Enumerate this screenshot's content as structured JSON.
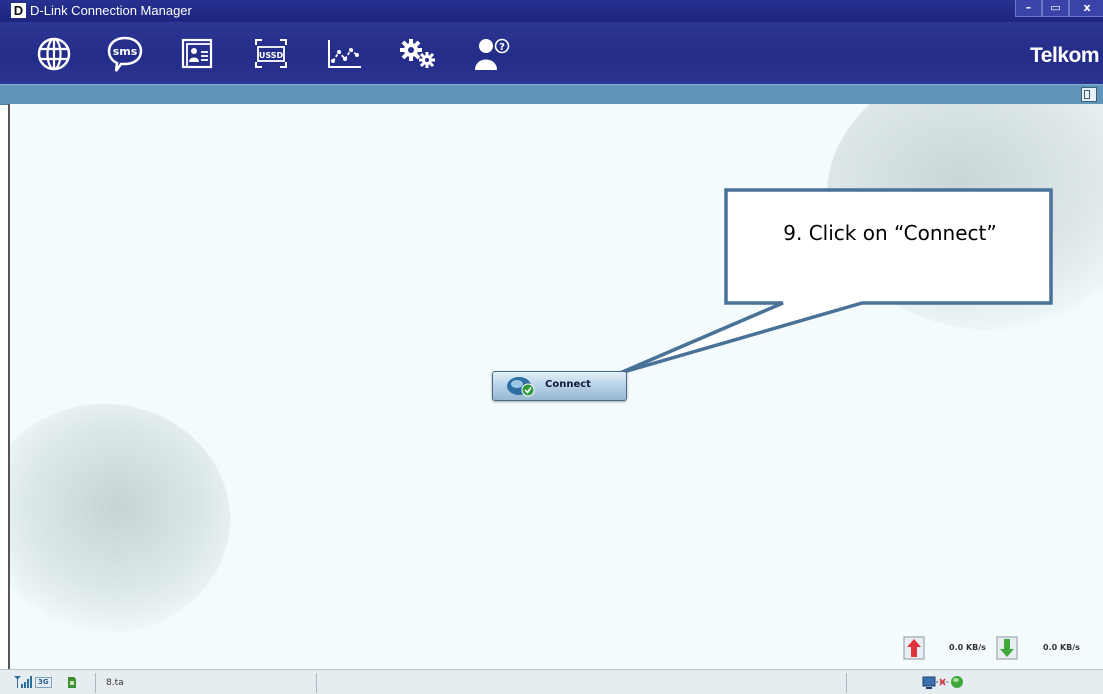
{
  "window": {
    "title": "D-Link Connection Manager",
    "logo_letter": "D",
    "controls": {
      "minimize": "–",
      "maximize": "▭",
      "close": "x"
    }
  },
  "toolbar": {
    "brand": "Telkom",
    "items": [
      {
        "name": "internet",
        "icon": "globe-icon"
      },
      {
        "name": "sms",
        "icon": "sms-bubble-icon",
        "icon_text": "sms"
      },
      {
        "name": "contacts",
        "icon": "contacts-card-icon"
      },
      {
        "name": "ussd",
        "icon": "ussd-icon",
        "icon_text": "USSD"
      },
      {
        "name": "statistics",
        "icon": "line-chart-icon"
      },
      {
        "name": "settings",
        "icon": "gears-icon"
      },
      {
        "name": "help",
        "icon": "help-user-icon"
      }
    ]
  },
  "main": {
    "connect_label": "Connect",
    "callout_text": "9. Click on “Connect”",
    "upload_speed": "0.0 KB/s",
    "download_speed": "0.0 KB/s"
  },
  "statusbar": {
    "network_type": "3G",
    "text": "8.ta"
  },
  "colors": {
    "title_bar": "#1c2580",
    "toolbar": "#232c88",
    "sub_bar": "#5f95b8",
    "main_bg": "#f3fbfd",
    "callout_border": "#4a7198"
  }
}
